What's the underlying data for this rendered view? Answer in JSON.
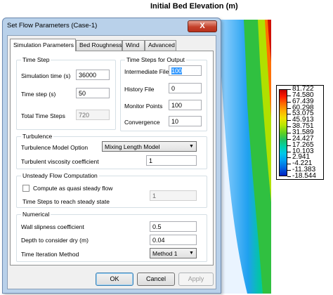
{
  "map": {
    "title": "Initial Bed Elevation (m)",
    "legend_values": [
      "81.722",
      "74.580",
      "67.439",
      "60.298",
      "53.075",
      "45.913",
      "38.751",
      "31.589",
      "24.427",
      "17.265",
      "10.103",
      "2.941",
      "-4.221",
      "-11.383",
      "-18.544"
    ],
    "legend_colors": [
      "#c00000",
      "#0020c0"
    ]
  },
  "dialog": {
    "title": "Set Flow Parameters (Case-1)",
    "close_label": "X",
    "tabs": [
      {
        "label": "Simulation Parameters",
        "active": true
      },
      {
        "label": "Bed Roughness",
        "active": false
      },
      {
        "label": "Wind",
        "active": false
      },
      {
        "label": "Advanced",
        "active": false
      }
    ],
    "time_step": {
      "title": "Time Step",
      "simulation_time_label": "Simulation time (s)",
      "simulation_time_value": "36000",
      "time_step_label": "Time step (s)",
      "time_step_value": "50",
      "total_steps_label": "Total Time Steps",
      "total_steps_value": "720"
    },
    "output": {
      "title": "Time Steps for Output",
      "intermediate_label": "Intermediate File",
      "intermediate_value": "100",
      "history_label": "History File",
      "history_value": "0",
      "monitor_label": "Monitor Points",
      "monitor_value": "100",
      "convergence_label": "Convergence",
      "convergence_value": "10"
    },
    "turbulence": {
      "title": "Turbulence",
      "model_label": "Turbulence Model Option",
      "model_value": "Mixing Length Model",
      "viscosity_label": "Turbulent viscosity coefficient",
      "viscosity_value": "1"
    },
    "unsteady": {
      "title": "Unsteady Flow Computation",
      "quasi_label": "Compute as quasi steady flow",
      "quasi_checked": false,
      "steps_label": "Time Steps to reach steady state",
      "steps_value": "1"
    },
    "numerical": {
      "title": "Numerical",
      "slipness_label": "Wall slipness coefficient",
      "slipness_value": "0.5",
      "dry_label": "Depth to consider dry (m)",
      "dry_value": "0.04",
      "method_label": "Time Iteration Method",
      "method_value": "Method 1"
    },
    "buttons": {
      "ok": "OK",
      "cancel": "Cancel",
      "apply": "Apply"
    }
  }
}
